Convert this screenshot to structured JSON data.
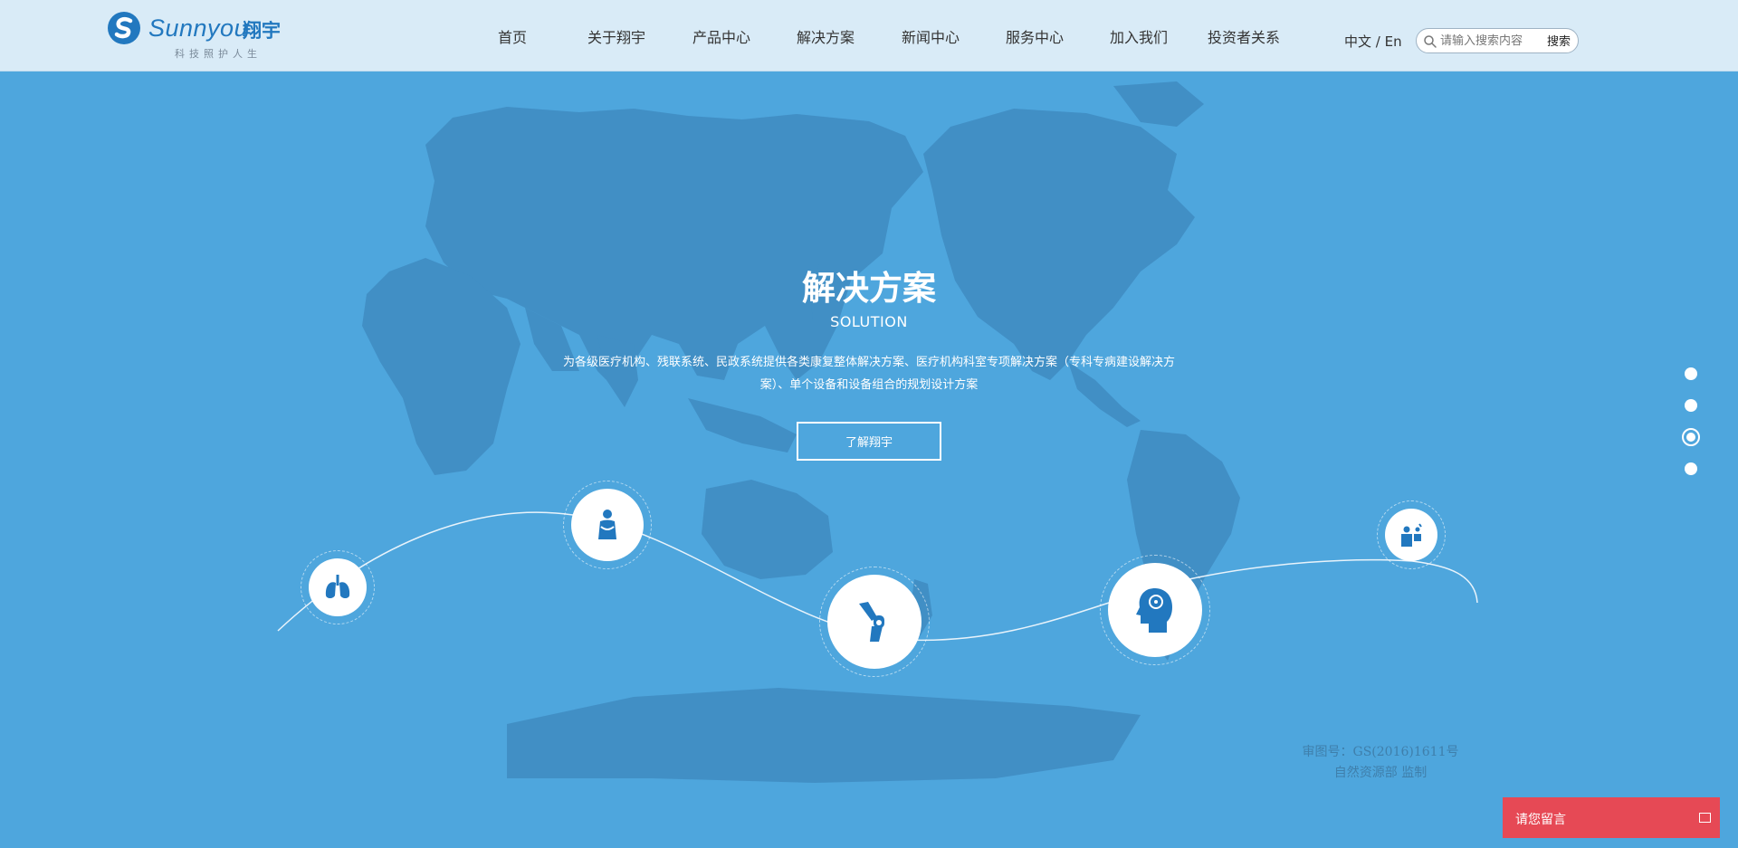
{
  "brand": {
    "name": "Sunnyou",
    "cn_name": "翔宇",
    "slogan": "科技照护人生"
  },
  "nav": {
    "items": [
      {
        "label": "首页"
      },
      {
        "label": "关于翔宇"
      },
      {
        "label": "产品中心"
      },
      {
        "label": "解决方案"
      },
      {
        "label": "新闻中心"
      },
      {
        "label": "服务中心"
      },
      {
        "label": "加入我们"
      },
      {
        "label": "投资者关系"
      }
    ]
  },
  "lang": {
    "zh": "中文",
    "sep": " / ",
    "en": "En"
  },
  "search": {
    "placeholder": "请输入搜索内容",
    "button": "搜索"
  },
  "hero": {
    "title": "解决方案",
    "subtitle": "SOLUTION",
    "description": "为各级医疗机构、残联系统、民政系统提供各类康复整体解决方案、医疗机构科室专项解决方案（专科专病建设解决方案）、单个设备和设备组合的规划设计方案",
    "button": "了解翔宇",
    "icons": [
      "lungs-icon",
      "pregnancy-icon",
      "knee-joint-icon",
      "brain-head-icon",
      "child-care-icon"
    ]
  },
  "map_note": {
    "line1": "审图号：GS(2016)1611号",
    "line2": "自然资源部 监制"
  },
  "pager": {
    "count": 4,
    "active": 3
  },
  "message": {
    "label": "请您留言"
  },
  "colors": {
    "header_bg": "#d9ebf7",
    "hero_bg": "#4ea6dd",
    "continent": "#3f8bc1",
    "accent": "#2278bf",
    "message_bg": "#e64955"
  }
}
